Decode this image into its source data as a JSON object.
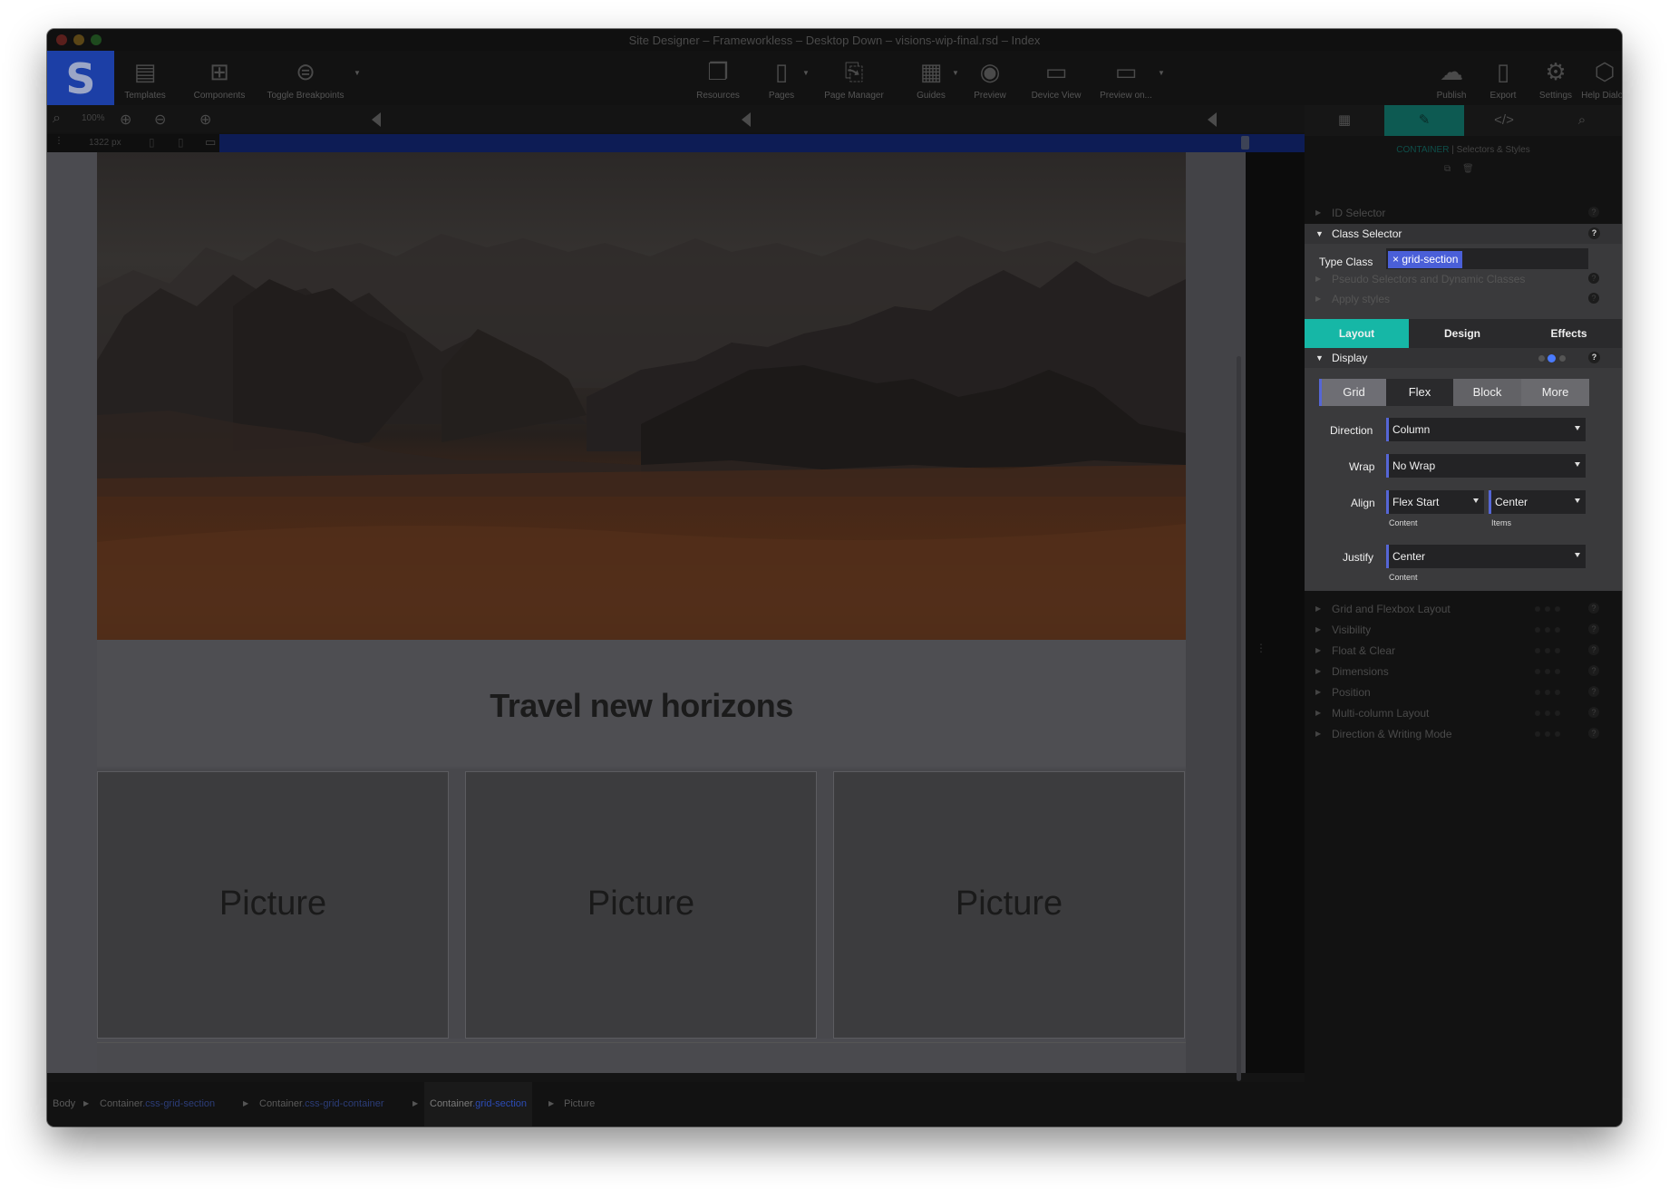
{
  "window": {
    "title": "Site Designer – Frameworkless – Desktop Down – visions-wip-final.rsd – Index"
  },
  "toolbar": {
    "logo": "S",
    "items": [
      {
        "label": "Templates",
        "icon": "paint-roller-icon"
      },
      {
        "label": "Components",
        "icon": "components-icon"
      },
      {
        "label": "Toggle Breakpoints",
        "icon": "toggle-icon"
      },
      {
        "label": "Resources",
        "icon": "resources-icon"
      },
      {
        "label": "Pages",
        "icon": "pages-icon"
      },
      {
        "label": "Page Manager",
        "icon": "page-manager-icon"
      },
      {
        "label": "Guides",
        "icon": "guides-icon"
      },
      {
        "label": "Preview",
        "icon": "eye-icon"
      },
      {
        "label": "Device View",
        "icon": "device-icon"
      },
      {
        "label": "Preview on...",
        "icon": "monitor-icon"
      },
      {
        "label": "Publish",
        "icon": "cloud-upload-icon"
      },
      {
        "label": "Export",
        "icon": "export-icon"
      },
      {
        "label": "Settings",
        "icon": "gear-icon"
      },
      {
        "label": "Help Dialog",
        "icon": "help-icon"
      }
    ]
  },
  "canvas_controls": {
    "zoom": "100%",
    "width": "1322 px"
  },
  "page": {
    "headline": "Travel new horizons",
    "pictures": [
      "Picture",
      "Picture",
      "Picture"
    ]
  },
  "breadcrumbs": [
    {
      "name": "Body",
      "class": ""
    },
    {
      "name": "Container",
      "class": ".css-grid-section"
    },
    {
      "name": "Container",
      "class": ".css-grid-container"
    },
    {
      "name": "Container",
      "class": ".grid-section"
    },
    {
      "name": "Picture",
      "class": ""
    }
  ],
  "panel": {
    "tabs": [
      "grid-icon",
      "brush-icon",
      "code-icon",
      "search-icon"
    ],
    "selector_title_highlight": "CONTAINER",
    "selector_title_rest": " | Selectors & Styles",
    "id_selector": "ID Selector",
    "class_selector": "Class Selector",
    "type_class_label": "Type Class",
    "class_tag": "grid-section",
    "pseudo": "Pseudo Selectors and Dynamic Classes",
    "apply_styles": "Apply styles",
    "style_tabs": [
      "Layout",
      "Design",
      "Effects"
    ],
    "display": "Display",
    "display_modes": [
      "Grid",
      "Flex",
      "Block",
      "More"
    ],
    "direction_label": "Direction",
    "direction_value": "Column",
    "wrap_label": "Wrap",
    "wrap_value": "No Wrap",
    "align_label": "Align",
    "align_content_value": "Flex Start",
    "align_items_value": "Center",
    "content_sub": "Content",
    "items_sub": "Items",
    "justify_label": "Justify",
    "justify_value": "Center",
    "justify_sub": "Content",
    "sections": [
      "Grid and Flexbox Layout",
      "Visibility",
      "Float & Clear",
      "Dimensions",
      "Position",
      "Multi-column Layout",
      "Direction & Writing Mode"
    ],
    "help": "?"
  },
  "colors": {
    "accent_teal": "#16b7a6",
    "accent_blue": "#5566d6",
    "logo_blue": "#1c3fa6"
  }
}
